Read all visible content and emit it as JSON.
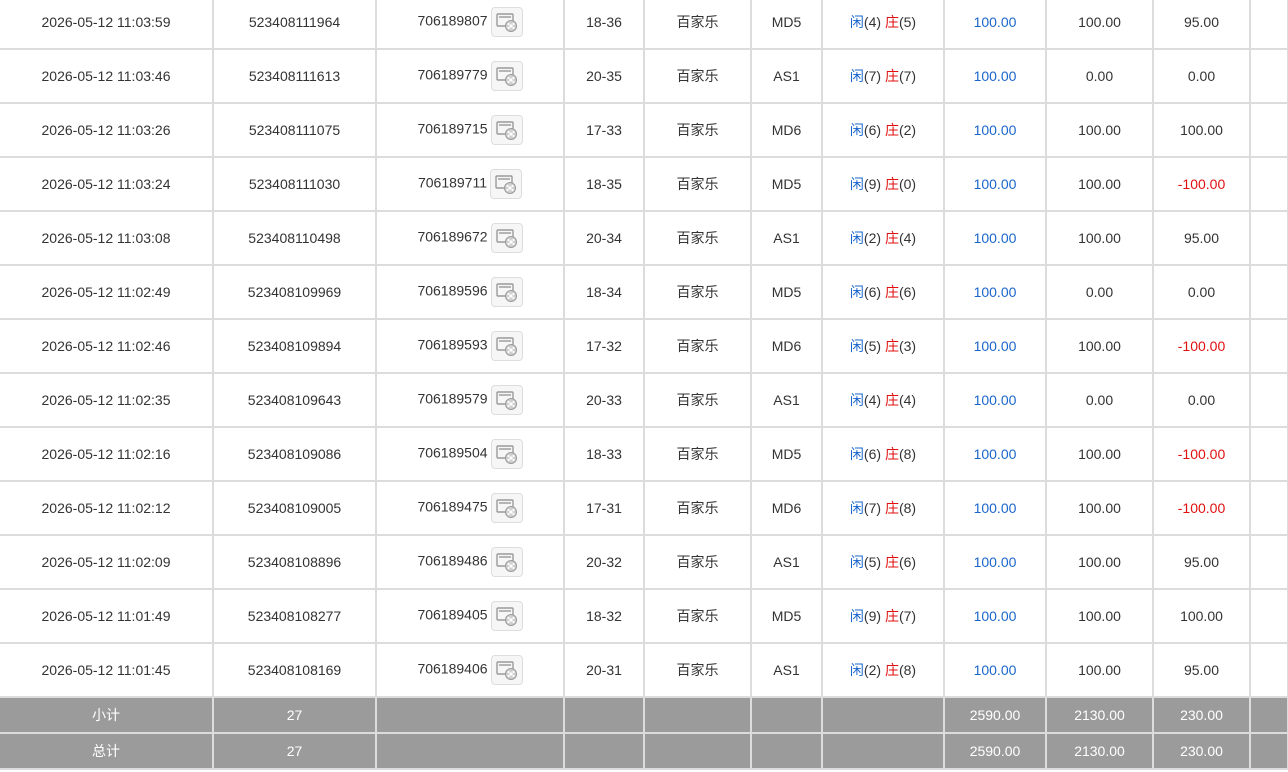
{
  "game_name": "百家乐",
  "result_labels": {
    "player": "闲",
    "banker": "庄"
  },
  "colors": {
    "blue_value": "#1a66cc",
    "negative_value": "#e01010",
    "summary_bg": "#9b9b9b"
  },
  "icons": {
    "replay": "video-replay-icon"
  },
  "rows": [
    {
      "time": "2026-05-12 11:03:59",
      "order": "523408111964",
      "round": "706189807",
      "seat": "18-36",
      "game": "百家乐",
      "table": "MD5",
      "player": 4,
      "banker": 5,
      "bet": "100.00",
      "valid": "100.00",
      "winloss": "95.00",
      "negative": false
    },
    {
      "time": "2026-05-12 11:03:46",
      "order": "523408111613",
      "round": "706189779",
      "seat": "20-35",
      "game": "百家乐",
      "table": "AS1",
      "player": 7,
      "banker": 7,
      "bet": "100.00",
      "valid": "0.00",
      "winloss": "0.00",
      "negative": false
    },
    {
      "time": "2026-05-12 11:03:26",
      "order": "523408111075",
      "round": "706189715",
      "seat": "17-33",
      "game": "百家乐",
      "table": "MD6",
      "player": 6,
      "banker": 2,
      "bet": "100.00",
      "valid": "100.00",
      "winloss": "100.00",
      "negative": false
    },
    {
      "time": "2026-05-12 11:03:24",
      "order": "523408111030",
      "round": "706189711",
      "seat": "18-35",
      "game": "百家乐",
      "table": "MD5",
      "player": 9,
      "banker": 0,
      "bet": "100.00",
      "valid": "100.00",
      "winloss": "-100.00",
      "negative": true
    },
    {
      "time": "2026-05-12 11:03:08",
      "order": "523408110498",
      "round": "706189672",
      "seat": "20-34",
      "game": "百家乐",
      "table": "AS1",
      "player": 2,
      "banker": 4,
      "bet": "100.00",
      "valid": "100.00",
      "winloss": "95.00",
      "negative": false
    },
    {
      "time": "2026-05-12 11:02:49",
      "order": "523408109969",
      "round": "706189596",
      "seat": "18-34",
      "game": "百家乐",
      "table": "MD5",
      "player": 6,
      "banker": 6,
      "bet": "100.00",
      "valid": "0.00",
      "winloss": "0.00",
      "negative": false
    },
    {
      "time": "2026-05-12 11:02:46",
      "order": "523408109894",
      "round": "706189593",
      "seat": "17-32",
      "game": "百家乐",
      "table": "MD6",
      "player": 5,
      "banker": 3,
      "bet": "100.00",
      "valid": "100.00",
      "winloss": "-100.00",
      "negative": true
    },
    {
      "time": "2026-05-12 11:02:35",
      "order": "523408109643",
      "round": "706189579",
      "seat": "20-33",
      "game": "百家乐",
      "table": "AS1",
      "player": 4,
      "banker": 4,
      "bet": "100.00",
      "valid": "0.00",
      "winloss": "0.00",
      "negative": false
    },
    {
      "time": "2026-05-12 11:02:16",
      "order": "523408109086",
      "round": "706189504",
      "seat": "18-33",
      "game": "百家乐",
      "table": "MD5",
      "player": 6,
      "banker": 8,
      "bet": "100.00",
      "valid": "100.00",
      "winloss": "-100.00",
      "negative": true
    },
    {
      "time": "2026-05-12 11:02:12",
      "order": "523408109005",
      "round": "706189475",
      "seat": "17-31",
      "game": "百家乐",
      "table": "MD6",
      "player": 7,
      "banker": 8,
      "bet": "100.00",
      "valid": "100.00",
      "winloss": "-100.00",
      "negative": true
    },
    {
      "time": "2026-05-12 11:02:09",
      "order": "523408108896",
      "round": "706189486",
      "seat": "20-32",
      "game": "百家乐",
      "table": "AS1",
      "player": 5,
      "banker": 6,
      "bet": "100.00",
      "valid": "100.00",
      "winloss": "95.00",
      "negative": false
    },
    {
      "time": "2026-05-12 11:01:49",
      "order": "523408108277",
      "round": "706189405",
      "seat": "18-32",
      "game": "百家乐",
      "table": "MD5",
      "player": 9,
      "banker": 7,
      "bet": "100.00",
      "valid": "100.00",
      "winloss": "100.00",
      "negative": false
    },
    {
      "time": "2026-05-12 11:01:45",
      "order": "523408108169",
      "round": "706189406",
      "seat": "20-31",
      "game": "百家乐",
      "table": "AS1",
      "player": 2,
      "banker": 8,
      "bet": "100.00",
      "valid": "100.00",
      "winloss": "95.00",
      "negative": false
    }
  ],
  "subtotal": {
    "label": "小计",
    "count": "27",
    "bet": "2590.00",
    "valid": "2130.00",
    "winloss": "230.00"
  },
  "total": {
    "label": "总计",
    "count": "27",
    "bet": "2590.00",
    "valid": "2130.00",
    "winloss": "230.00"
  }
}
